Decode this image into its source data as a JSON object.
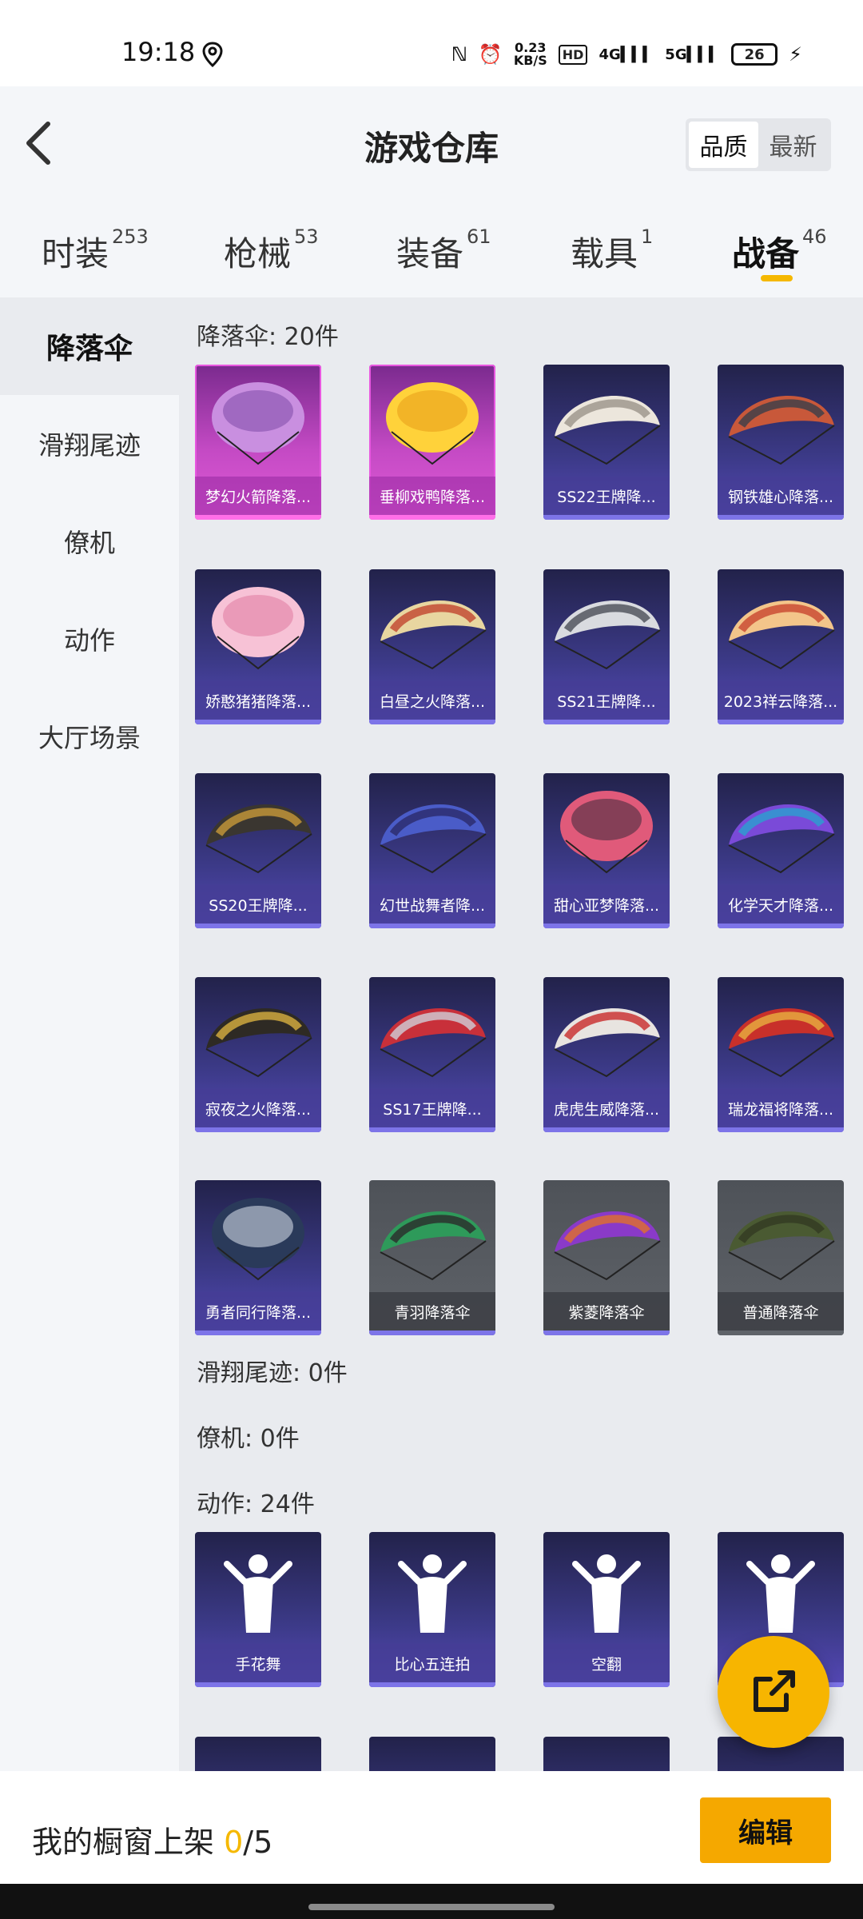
{
  "status_bar": {
    "time": "19:18",
    "net_speed_value": "0.23",
    "net_speed_unit": "KB/S",
    "hd": "HD",
    "sig1": "4G",
    "sig2": "5G",
    "battery": "26"
  },
  "header": {
    "title": "游戏仓库",
    "sort": [
      "品质",
      "最新"
    ]
  },
  "tabs": [
    {
      "label": "时装",
      "count": "253"
    },
    {
      "label": "枪械",
      "count": "53"
    },
    {
      "label": "装备",
      "count": "61"
    },
    {
      "label": "载具",
      "count": "1"
    },
    {
      "label": "战备",
      "count": "46"
    }
  ],
  "sidebar": [
    "降落伞",
    "滑翔尾迹",
    "僚机",
    "动作",
    "大厅场景"
  ],
  "sections": {
    "parachute_title": "降落伞: 20件",
    "trail_title": "滑翔尾迹: 0件",
    "wingman_title": "僚机: 0件",
    "action_title": "动作: 24件"
  },
  "parachutes": [
    {
      "label": "梦幻火箭降落...",
      "rarity": "pink",
      "c1": "#c98fe0",
      "c2": "#7d4aa8"
    },
    {
      "label": "垂柳戏鸭降落...",
      "rarity": "pink",
      "c1": "#ffd23a",
      "c2": "#e89a18"
    },
    {
      "label": "SS22王牌降...",
      "rarity": "purple",
      "c1": "#ece6dc",
      "c2": "#9b948a"
    },
    {
      "label": "钢铁雄心降落...",
      "rarity": "purple",
      "c1": "#c8583a",
      "c2": "#3a3f4a"
    },
    {
      "label": "娇憨猪猪降落...",
      "rarity": "purple",
      "c1": "#f7c2d6",
      "c2": "#e07aa0"
    },
    {
      "label": "白昼之火降落...",
      "rarity": "purple",
      "c1": "#e8d6a0",
      "c2": "#c0452e"
    },
    {
      "label": "SS21王牌降...",
      "rarity": "purple",
      "c1": "#d9dbdf",
      "c2": "#4a4e56"
    },
    {
      "label": "2023祥云降落...",
      "rarity": "purple",
      "c1": "#f3c58a",
      "c2": "#c8452e"
    },
    {
      "label": "SS20王牌降...",
      "rarity": "purple",
      "c1": "#3a3630",
      "c2": "#c89a3a"
    },
    {
      "label": "幻世战舞者降...",
      "rarity": "purple",
      "c1": "#4a5cc8",
      "c2": "#2a2a6a"
    },
    {
      "label": "甜心亚梦降落...",
      "rarity": "purple",
      "c1": "#e05a7a",
      "c2": "#3a2a3a"
    },
    {
      "label": "化学天才降落...",
      "rarity": "purple",
      "c1": "#7a4ad8",
      "c2": "#2aa0d0"
    },
    {
      "label": "寂夜之火降落...",
      "rarity": "purple",
      "c1": "#2e2a24",
      "c2": "#d8b040"
    },
    {
      "label": "SS17王牌降...",
      "rarity": "purple",
      "c1": "#c8303a",
      "c2": "#d0d0d8"
    },
    {
      "label": "虎虎生威降落...",
      "rarity": "purple",
      "c1": "#e8e4e0",
      "c2": "#c82a2a"
    },
    {
      "label": "瑞龙福将降落...",
      "rarity": "purple",
      "c1": "#c8302a",
      "c2": "#e8b040"
    },
    {
      "label": "勇者同行降落...",
      "rarity": "purple",
      "c1": "#2a3a5a",
      "c2": "#dfe6f0"
    },
    {
      "label": "青羽降落伞",
      "rarity": "gray",
      "c1": "#2e9a5a",
      "c2": "#2a2a2a"
    },
    {
      "label": "紫菱降落伞",
      "rarity": "gray",
      "c1": "#8a3ac8",
      "c2": "#e0702a"
    },
    {
      "label": "普通降落伞",
      "rarity": "gray",
      "c1": "#4a5a32",
      "c2": "#323a22"
    }
  ],
  "actions": [
    {
      "label": "手花舞"
    },
    {
      "label": "比心五连拍"
    },
    {
      "label": "空翻"
    },
    {
      "label": ""
    }
  ],
  "bottom": {
    "shelf_label": "我的橱窗上架 ",
    "shelf_count": "0",
    "shelf_total": "/5",
    "edit": "编辑"
  }
}
